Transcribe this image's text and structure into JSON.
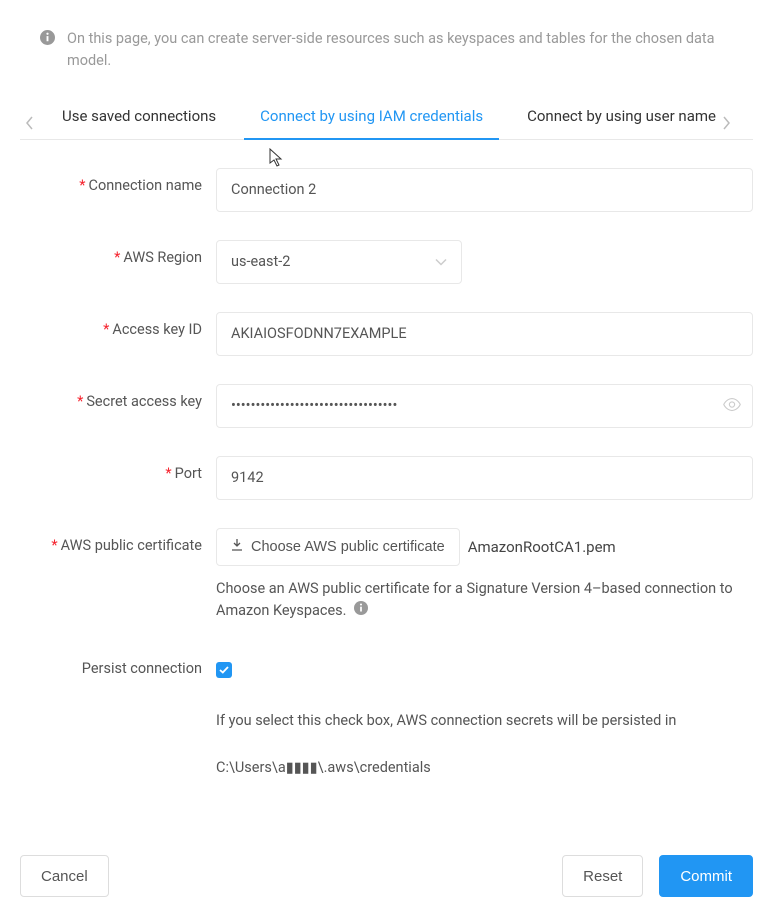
{
  "banner": {
    "text": "On this page, you can create server-side resources such as keyspaces and tables for the chosen data model."
  },
  "tabs": {
    "items": [
      {
        "label": "Use saved connections"
      },
      {
        "label": "Connect by using IAM credentials"
      },
      {
        "label": "Connect by using user name"
      }
    ],
    "activeIndex": 1
  },
  "labels": {
    "connection_name": "Connection name",
    "aws_region": "AWS Region",
    "access_key_id": "Access key ID",
    "secret_access_key": "Secret access key",
    "port": "Port",
    "aws_public_cert": "AWS public certificate",
    "persist_connection": "Persist connection"
  },
  "fields": {
    "connection_name": "Connection 2",
    "aws_region": "us-east-2",
    "access_key_id": "AKIAIOSFODNN7EXAMPLE",
    "secret_access_key": "••••••••••••••••••••••••••••••••••",
    "port": "9142",
    "certificate_filename": "AmazonRootCA1.pem",
    "persist_checked": true
  },
  "cert": {
    "button_label": "Choose AWS public certificate",
    "help_text": "Choose an AWS public certificate for a Signature Version 4–based connection to Amazon Keyspaces."
  },
  "persist": {
    "help_text": "If you select this check box, AWS connection secrets will be persisted in",
    "path": "C:\\Users\\a▮▮▮▮\\.aws\\credentials"
  },
  "footer": {
    "cancel": "Cancel",
    "reset": "Reset",
    "commit": "Commit"
  }
}
